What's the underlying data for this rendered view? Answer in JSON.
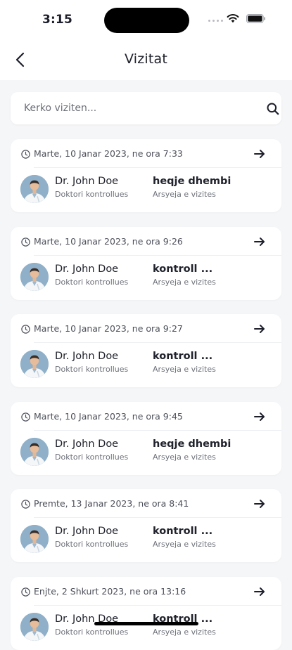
{
  "status_bar": {
    "time": "3:15"
  },
  "header": {
    "title": "Vizitat"
  },
  "search": {
    "placeholder": "Kerko viziten...",
    "value": ""
  },
  "visits": [
    {
      "date": "Marte, 10 Janar 2023, ne ora 7:33",
      "doctor": "Dr. John Doe",
      "doctor_label": "Doktori kontrollues",
      "reason": "heqje dhembi",
      "reason_label": "Arsyeja e vizites"
    },
    {
      "date": "Marte, 10 Janar 2023, ne ora 9:26",
      "doctor": "Dr. John Doe",
      "doctor_label": "Doktori kontrollues",
      "reason": "kontroll ...",
      "reason_label": "Arsyeja e vizites"
    },
    {
      "date": "Marte, 10 Janar 2023, ne ora 9:27",
      "doctor": "Dr. John Doe",
      "doctor_label": "Doktori kontrollues",
      "reason": "kontroll ...",
      "reason_label": "Arsyeja e vizites"
    },
    {
      "date": "Marte, 10 Janar 2023, ne ora 9:45",
      "doctor": "Dr. John Doe",
      "doctor_label": "Doktori kontrollues",
      "reason": "heqje dhembi",
      "reason_label": "Arsyeja e vizites"
    },
    {
      "date": "Premte, 13 Janar 2023, ne ora 8:41",
      "doctor": "Dr. John Doe",
      "doctor_label": "Doktori kontrollues",
      "reason": "kontroll ...",
      "reason_label": "Arsyeja e vizites"
    },
    {
      "date": "Enjte, 2 Shkurt 2023, ne ora 13:16",
      "doctor": "Dr. John Doe",
      "doctor_label": "Doktori kontrollues",
      "reason": "kontroll ...",
      "reason_label": "Arsyeja e vizites"
    }
  ],
  "colors": {
    "background": "#f5f6f8",
    "card": "#ffffff",
    "text": "#20222c",
    "muted": "#6c6f78"
  }
}
